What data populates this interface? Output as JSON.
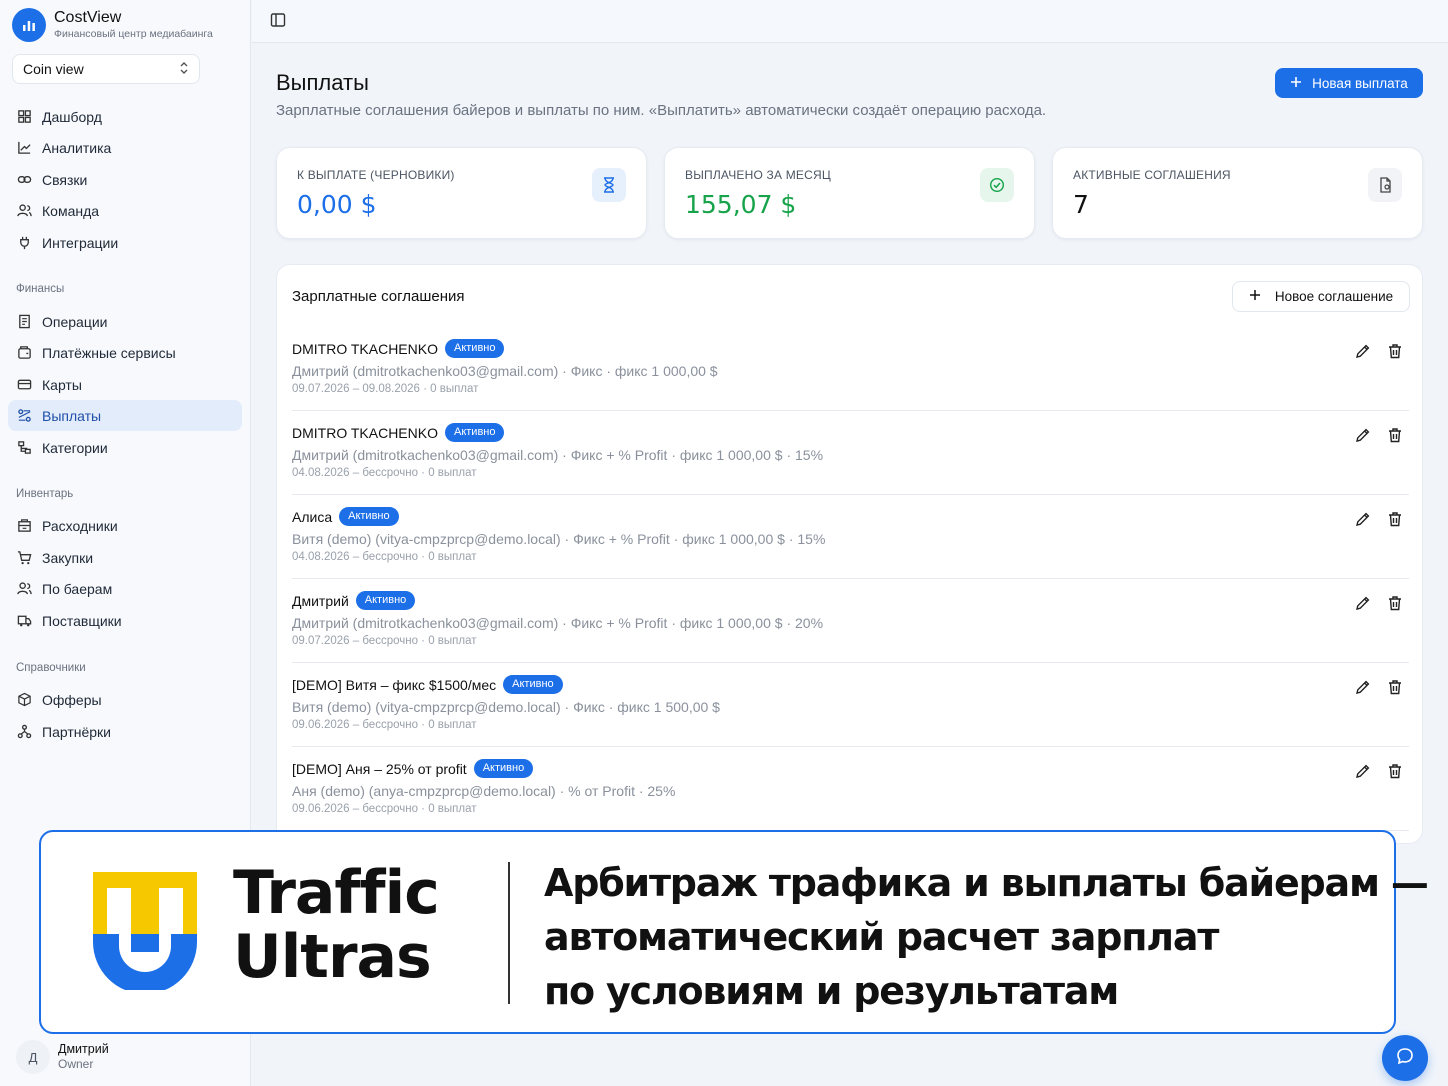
{
  "app": {
    "title": "CostView",
    "subtitle": "Финансовый центр медиабаинга"
  },
  "view_select": {
    "value": "Coin view"
  },
  "sidebar": {
    "main": [
      {
        "label": "Дашборд",
        "icon": "dashboard-icon"
      },
      {
        "label": "Аналитика",
        "icon": "chart-line-icon"
      },
      {
        "label": "Связки",
        "icon": "link-icon"
      },
      {
        "label": "Команда",
        "icon": "users-icon"
      },
      {
        "label": "Интеграции",
        "icon": "plug-icon"
      }
    ],
    "finance_title": "Финансы",
    "finance": [
      {
        "label": "Операции",
        "icon": "receipt-icon"
      },
      {
        "label": "Платёжные сервисы",
        "icon": "wallet-icon"
      },
      {
        "label": "Карты",
        "icon": "credit-card-icon"
      },
      {
        "label": "Выплаты",
        "icon": "payouts-icon",
        "active": true
      },
      {
        "label": "Категории",
        "icon": "categories-icon"
      }
    ],
    "inventory_title": "Инвентарь",
    "inventory": [
      {
        "label": "Расходники",
        "icon": "box-icon"
      },
      {
        "label": "Закупки",
        "icon": "cart-icon"
      },
      {
        "label": "По баерам",
        "icon": "users-icon"
      },
      {
        "label": "Поставщики",
        "icon": "truck-icon"
      }
    ],
    "refs_title": "Справочники",
    "refs": [
      {
        "label": "Офферы",
        "icon": "package-icon"
      },
      {
        "label": "Партнёрки",
        "icon": "network-icon"
      }
    ]
  },
  "user": {
    "initial": "Д",
    "name": "Дмитрий",
    "role": "Owner"
  },
  "page": {
    "title": "Выплаты",
    "description": "Зарплатные соглашения байеров и выплаты по ним. «Выплатить» автоматически создаёт операцию расхода.",
    "new_payout_label": "Новая выплата"
  },
  "stats": [
    {
      "label": "К ВЫПЛАТЕ (ЧЕРНОВИКИ)",
      "value": "0,00 $",
      "color": "#1d6fe8",
      "icon": "hourglass-icon"
    },
    {
      "label": "ВЫПЛАЧЕНО ЗА МЕСЯЦ",
      "value": "155,07 $",
      "color": "#16a34a",
      "icon": "check-circle-icon"
    },
    {
      "label": "АКТИВНЫЕ СОГЛАШЕНИЯ",
      "value": "7",
      "color": "#111111",
      "icon": "document-icon"
    }
  ],
  "agreements": {
    "title": "Зарплатные соглашения",
    "new_label": "Новое соглашение",
    "rows": [
      {
        "name": "DMITRO TKACHENKO",
        "status": "Активно",
        "details": "Дмитрий (dmitrotkachenko03@gmail.com) · Фикс · фикс 1 000,00 $",
        "meta": "09.07.2026 – 09.08.2026 · 0 выплат"
      },
      {
        "name": "DMITRO TKACHENKO",
        "status": "Активно",
        "details": "Дмитрий (dmitrotkachenko03@gmail.com) · Фикс + % Profit · фикс 1 000,00 $ · 15%",
        "meta": "04.08.2026 – бессрочно · 0 выплат"
      },
      {
        "name": "Алиса",
        "status": "Активно",
        "details": "Витя (demo) (vitya-cmpzprcp@demo.local) · Фикс + % Profit · фикс 1 000,00 $ · 15%",
        "meta": "04.08.2026 – бессрочно · 0 выплат"
      },
      {
        "name": "Дмитрий",
        "status": "Активно",
        "details": "Дмитрий (dmitrotkachenko03@gmail.com) · Фикс + % Profit · фикс 1 000,00 $ · 20%",
        "meta": "09.07.2026 – бессрочно · 0 выплат"
      },
      {
        "name": "[DEMO] Витя – фикс $1500/мес",
        "status": "Активно",
        "details": "Витя (demo) (vitya-cmpzprcp@demo.local) · Фикс · фикс 1 500,00 $",
        "meta": "09.06.2026 – бессрочно · 0 выплат"
      },
      {
        "name": "[DEMO] Аня – 25% от profit",
        "status": "Активно",
        "details": "Аня (demo) (anya-cmpzprcp@demo.local) · % от Profit · 25%",
        "meta": "09.06.2026 – бессрочно · 0 выплат"
      }
    ]
  },
  "banner": {
    "brand_line1": "Traffic",
    "brand_line2": "Ultras",
    "headline": [
      "Арбитраж трафика и выплаты байерам —",
      "автоматический расчет зарплат",
      "по условиям и результатам"
    ],
    "logo_colors": {
      "top": "#f5c800",
      "bottom": "#1d6fe8"
    }
  }
}
